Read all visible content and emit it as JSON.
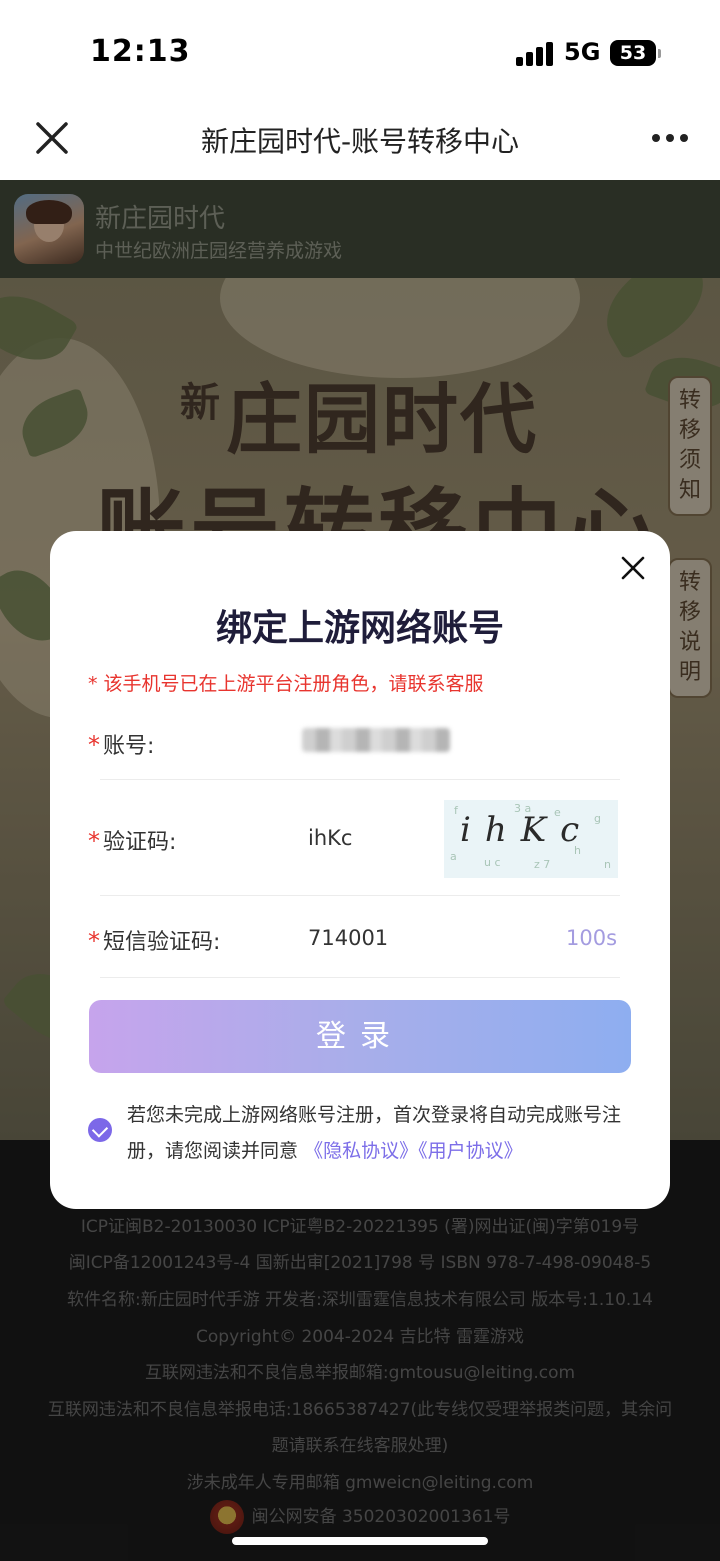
{
  "status_bar": {
    "time": "12:13",
    "network": "5G",
    "battery": "53"
  },
  "nav": {
    "title": "新庄园时代-账号转移中心"
  },
  "app_header": {
    "name": "新庄园时代",
    "desc": "中世纪欧洲庄园经营养成游戏"
  },
  "hero": {
    "title_prefix": "新",
    "title_main": "庄园时代",
    "subtitle": "账号转移中心"
  },
  "side_tabs": {
    "notice": "转移须知",
    "explain": "转移说明"
  },
  "modal": {
    "title": "绑定上游网络账号",
    "warning": "* 该手机号已在上游平台注册角色，请联系客服",
    "required_mark": "*",
    "account_label": "账号:",
    "captcha_label": "验证码:",
    "captcha_value": "ihKc",
    "captcha_image_text": "ihKc",
    "sms_label": "短信验证码:",
    "sms_value": "714001",
    "countdown": "100s",
    "login_button": "登录",
    "agreement_text": "若您未完成上游网络账号注册，首次登录将自动完成账号注册，请您阅读并同意",
    "privacy_link": "《隐私协议》",
    "user_link": "《用户协议》"
  },
  "footer": {
    "lines": [
      "ICP证闽B2-20130030 ICP证粤B2-20221395 (署)网出证(闽)字第019号",
      "闽ICP备12001243号-4 国新出审[2021]798 号 ISBN 978-7-498-09048-5",
      "软件名称:新庄园时代手游 开发者:深圳雷霆信息技术有限公司 版本号:1.10.14",
      "Copyright© 2004-2024 吉比特 雷霆游戏",
      "互联网违法和不良信息举报邮箱:gmtousu@leiting.com",
      "互联网违法和不良信息举报电话:18665387427(此专线仅受理举报类问题，其余问",
      "题请联系在线客服处理)",
      "涉未成年人专用邮箱 gmweicn@leiting.com",
      "闽公网安备 35020302001361号"
    ]
  }
}
